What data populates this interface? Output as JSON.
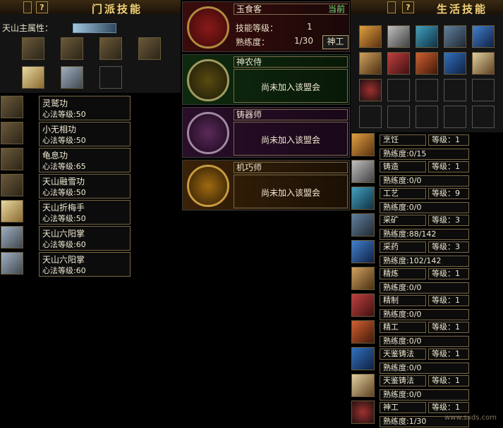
{
  "sect_panel": {
    "title": "门派技能",
    "main_attribute_label": "天山主属性：",
    "skills": [
      {
        "name": "灵鹫功",
        "level": "心法等级:50"
      },
      {
        "name": "小无相功",
        "level": "心法等级:50"
      },
      {
        "name": "龟息功",
        "level": "心法等级:65"
      },
      {
        "name": "天山融雪功",
        "level": "心法等级:50"
      },
      {
        "name": "天山折梅手",
        "level": "心法等级:50"
      },
      {
        "name": "天山六阳掌",
        "level": "心法等级:60"
      },
      {
        "name": "天山六阳掌",
        "level": "心法等级:60"
      }
    ]
  },
  "guild_panel": {
    "current": {
      "name": "玉食客",
      "badge": "当前",
      "level_label": "技能等级：",
      "level_value": "1",
      "proficiency_label": "熟练度：",
      "proficiency_value": "1/30",
      "button": "神工"
    },
    "others": [
      {
        "name": "神农侍",
        "status": "尚未加入该盟会"
      },
      {
        "name": "铸器师",
        "status": "尚未加入该盟会"
      },
      {
        "name": "机巧师",
        "status": "尚未加入该盟会"
      }
    ]
  },
  "life_panel": {
    "title": "生活技能",
    "help_icon": "?",
    "skills": [
      {
        "name": "烹饪",
        "level": "等级：1",
        "proficiency": "熟练度:0/15"
      },
      {
        "name": "铸造",
        "level": "等级：1",
        "proficiency": "熟练度:0/0"
      },
      {
        "name": "工艺",
        "level": "等级：9",
        "proficiency": "熟练度:0/0"
      },
      {
        "name": "采矿",
        "level": "等级：3",
        "proficiency": "熟练度:88/142"
      },
      {
        "name": "采药",
        "level": "等级：3",
        "proficiency": "熟练度:102/142"
      },
      {
        "name": "精炼",
        "level": "等级：1",
        "proficiency": "熟练度:0/0"
      },
      {
        "name": "精制",
        "level": "等级：1",
        "proficiency": "熟练度:0/0"
      },
      {
        "name": "精工",
        "level": "等级：1",
        "proficiency": "熟练度:0/0"
      },
      {
        "name": "天鉴铸法",
        "level": "等级：1",
        "proficiency": "熟练度:0/0"
      },
      {
        "name": "天鉴铸法",
        "level": "等级：1",
        "proficiency": "熟练度:0/0"
      },
      {
        "name": "神工",
        "level": "等级：1",
        "proficiency": "熟练度:1/30"
      }
    ]
  },
  "watermark": "www.sxds.com",
  "colors": {
    "gold": "#f3d27a",
    "border": "#7a6a48",
    "background": "#000000"
  }
}
